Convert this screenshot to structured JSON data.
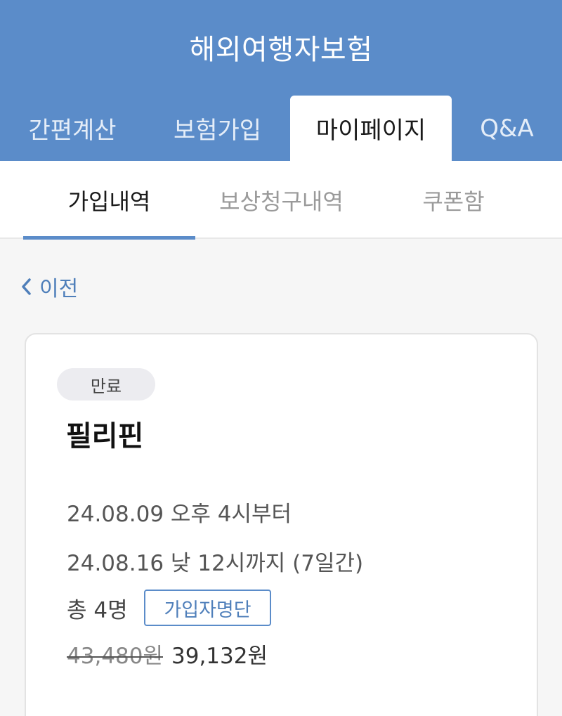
{
  "header": {
    "title": "해외여행자보험",
    "background_color": "#5b8cc9"
  },
  "main_tabs": [
    {
      "label": "간편계산",
      "active": false
    },
    {
      "label": "보험가입",
      "active": false
    },
    {
      "label": "마이페이지",
      "active": true
    },
    {
      "label": "Q&A",
      "active": false
    }
  ],
  "sub_tabs": [
    {
      "label": "가입내역",
      "active": true
    },
    {
      "label": "보상청구내역",
      "active": false
    },
    {
      "label": "쿠폰함",
      "active": false
    }
  ],
  "back": {
    "label": "이전",
    "icon": "chevron-left-icon"
  },
  "policy": {
    "status": "만료",
    "destination": "필리핀",
    "start": "24.08.09 오후 4시부터",
    "end": "24.08.16 낮 12시까지 (7일간)",
    "travelers": "총 4명",
    "roster_label": "가입자명단",
    "original_price": "43,480원",
    "final_price": "39,132원"
  },
  "colors": {
    "accent": "#5b8cc9",
    "link": "#4f7fba",
    "page_background": "#f6f6f6"
  }
}
